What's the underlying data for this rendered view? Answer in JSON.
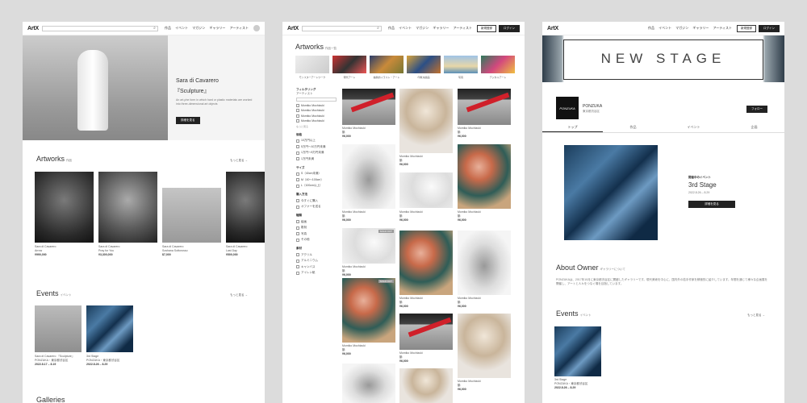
{
  "brand": {
    "logo": "ArtX"
  },
  "nav": {
    "items": [
      "作品",
      "イベント",
      "マガジン",
      "ギャラリー",
      "アーティスト"
    ]
  },
  "nav2": {
    "items": [
      "作品",
      "イベント",
      "マガジン",
      "ギャラリー",
      "アーティスト"
    ],
    "register": "新規登録",
    "login": "ログイン"
  },
  "p1": {
    "hero": {
      "artist": "Sara di Cavarero",
      "title": "『Sculpture』",
      "desc": "An art-phe form in which hard or plastic materials are worked into three-dimensional art objects",
      "cta": "詳細を見る"
    },
    "artworks": {
      "title": "Artworks",
      "sub": "作品",
      "more": "もっと見る →",
      "items": [
        {
          "artist": "Sara di Cavarero",
          "title": "Arrow",
          "price": "¥990,000"
        },
        {
          "artist": "Sara di Cavarero",
          "title": "Pray for You",
          "price": "¥3,300,000"
        },
        {
          "artist": "Sara di Cavarero",
          "title": "Soshana Sottorosso",
          "price": "$7,000"
        },
        {
          "artist": "Sara di Cavarero",
          "title": "Last Day",
          "price": "¥500,000"
        }
      ]
    },
    "events": {
      "title": "Events",
      "sub": "イベント",
      "more": "もっと見る →",
      "items": [
        {
          "title": "Sara di Cavarero 『Sculpture』",
          "venue": "PONZUKA・東京都渋谷区",
          "date": "2022.8.17 – 8.19"
        },
        {
          "title": "3rd Stage",
          "venue": "PONZUKA・東京都渋谷区",
          "date": "2022.8.26 – 8.29"
        }
      ]
    },
    "galleries": {
      "title": "Galleries"
    }
  },
  "p2": {
    "title": "Artworks",
    "sub": "作品一覧",
    "cats": [
      "モンスターアートワーク",
      "現代アート",
      "抽象的イラスト・アート",
      "印象派絵画",
      "写真",
      "デジタルアート"
    ],
    "filter": {
      "title": "フィルタリング",
      "artist_label": "アーティスト",
      "artists": [
        "Momiko Mochizuki",
        "Momiko Mochizuki",
        "Momiko Mochizuki",
        "Momiko Mochizuki"
      ],
      "more": "もっと見る",
      "price_label": "価格",
      "prices": [
        "10万円以上",
        "5万円〜10万円未満",
        "1万円〜5万円未満",
        "1万円未満"
      ],
      "size_label": "サイズ",
      "sizes": [
        "S（40cm未満）",
        "M（40〜100cm）",
        "L（100cm以上）"
      ],
      "buy_label": "購入方法",
      "buys": [
        "今すぐに購入",
        "オファーを送る"
      ],
      "type_label": "種類",
      "types": [
        "絵画",
        "彫刻",
        "写真",
        "その他"
      ],
      "mat_label": "素材",
      "mats": [
        "アクリル",
        "アルミニウム",
        "キャンバス",
        "アイレン紙"
      ]
    },
    "works": [
      {
        "artist": "Momiko Mochizuki",
        "title": "鶴",
        "price": "¥6,000"
      },
      {
        "artist": "Momiko Mochizuki",
        "title": "鶴",
        "price": "¥6,000"
      },
      {
        "artist": "Momiko Mochizuki",
        "title": "鶴",
        "price": "¥6,000"
      },
      {
        "artist": "Momiko Mochizuki",
        "title": "鶴",
        "price": "¥6,000"
      },
      {
        "artist": "Momiko Mochizuki",
        "title": "鶴",
        "price": "¥6,000"
      },
      {
        "artist": "Momiko Mochizuki",
        "title": "鶴",
        "price": "¥6,000"
      },
      {
        "artist": "Momiko Mochizuki",
        "title": "鶴",
        "price": "¥6,000"
      },
      {
        "artist": "Momiko Mochizuki",
        "title": "鶴",
        "price": "¥6,000"
      },
      {
        "artist": "Momiko Mochizuki",
        "title": "鶴",
        "price": "¥6,000"
      },
      {
        "artist": "Momiko Mochizuki",
        "title": "鶴",
        "price": "¥6,000"
      },
      {
        "artist": "Momiko Mochizuki",
        "title": "鶴",
        "price": "¥6,000"
      },
      {
        "artist": "Momiko Mochizuki",
        "title": "鶴",
        "price": "¥6,000"
      }
    ],
    "sold_out": "SOLD OUT"
  },
  "p3": {
    "banner": "NEW STAGE",
    "gallery": {
      "logo": "PONZUKA",
      "name": "PONZUKA",
      "loc": "東京都渋谷区",
      "follow": "フォロー"
    },
    "tabs": [
      "トップ",
      "作品",
      "イベント",
      "企画"
    ],
    "current": {
      "label": "開催中のイベント",
      "title": "3rd Stage",
      "date": "2022.8.26 – 8.29",
      "cta": "詳細を見る"
    },
    "about": {
      "title": "About Owner",
      "sub": "ギャラリーについて",
      "text": "PONZUKAは、2017年10月に東京都渋谷区に開廊したギャラリーです。現代美術を中心に、国内外の若手作家を積極的に紹介しています。年間を通じて様々な企画展を開催し、アートと人々をつなぐ場を目指しています。"
    },
    "events": {
      "title": "Events",
      "sub": "イベント",
      "more": "もっと見る →",
      "item": {
        "title": "3rd Stage",
        "venue": "PONZUKA・東京都渋谷区",
        "date": "2022.8.26 – 8.29"
      }
    }
  },
  "colors": {
    "accent": "#d0202a",
    "dark": "#222222",
    "bg": "#dcdcdc"
  }
}
